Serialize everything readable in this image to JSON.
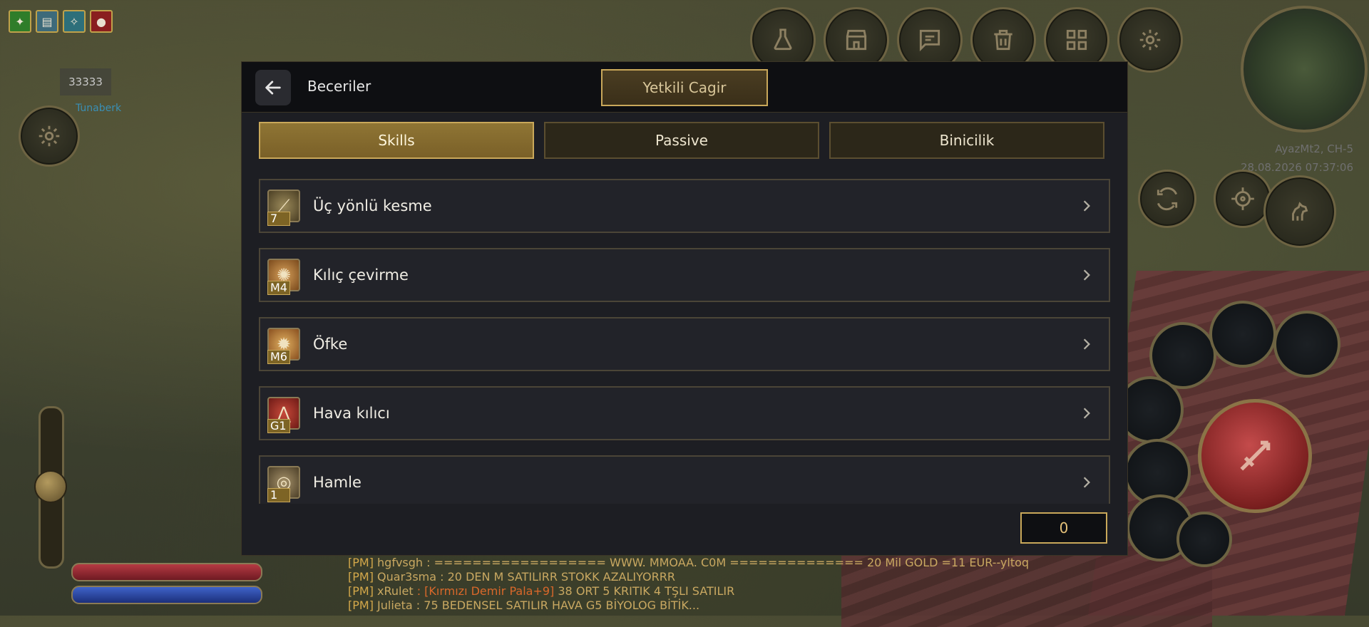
{
  "hud": {
    "buffs": [
      {
        "icon": "green-rune-icon",
        "color": "#2f7d2a"
      },
      {
        "icon": "scroll-icon",
        "color": "#3d6a7a"
      },
      {
        "icon": "teal-rune-icon",
        "color": "#2d6f7a"
      },
      {
        "icon": "red-potion-icon",
        "color": "#8a1f1f"
      }
    ],
    "target_value": "33333",
    "player_name": "Tunaberk",
    "server_name": "AyazMt2, CH-5",
    "server_time": "28.08.2026 07:37:06",
    "top_menu_icons": [
      "flask-icon",
      "shop-icon",
      "chat-icon",
      "trash-icon",
      "grid-icon",
      "gear-icon"
    ]
  },
  "dialog": {
    "title": "Beceriler",
    "summon_label": "Yetkili Cagir",
    "tabs": [
      {
        "label": "Skills",
        "active": true
      },
      {
        "label": "Passive",
        "active": false
      },
      {
        "label": "Binicilik",
        "active": false
      }
    ],
    "skills": [
      {
        "name": "Üç yönlü kesme",
        "level": "7",
        "icon": "triple-slash-icon"
      },
      {
        "name": "Kılıç çevirme",
        "level": "M4",
        "icon": "sword-spin-icon"
      },
      {
        "name": "Öfke",
        "level": "M6",
        "icon": "rage-icon"
      },
      {
        "name": "Hava kılıcı",
        "level": "G1",
        "icon": "aura-sword-icon"
      },
      {
        "name": "Hamle",
        "level": "1",
        "icon": "dash-icon"
      }
    ],
    "skill_points": "0"
  },
  "chat": [
    {
      "tag": "[PM]",
      "user": "hgfvsgh",
      "message": " : ================== WWW. MMOAA. C0M ============== 20 Mil GOLD =11 EUR--yltoq",
      "item": ""
    },
    {
      "tag": "[PM]",
      "user": "Quar3sma",
      "message": " :  20 DEN M SATILIRR STOKK AZALIYORRR",
      "item": ""
    },
    {
      "tag": "[PM]",
      "user": "xRulet",
      "message": " 38 ORT 5 KRITIK 4 TŞLI SATILIR",
      "item": " : [Kırmızı Demir Pala+9]"
    },
    {
      "tag": "[PM]",
      "user": "Julieta",
      "message": " : 75 BEDENSEL SATILIR HAVA G5 BİYOLOG BİTİK...",
      "item": ""
    }
  ]
}
